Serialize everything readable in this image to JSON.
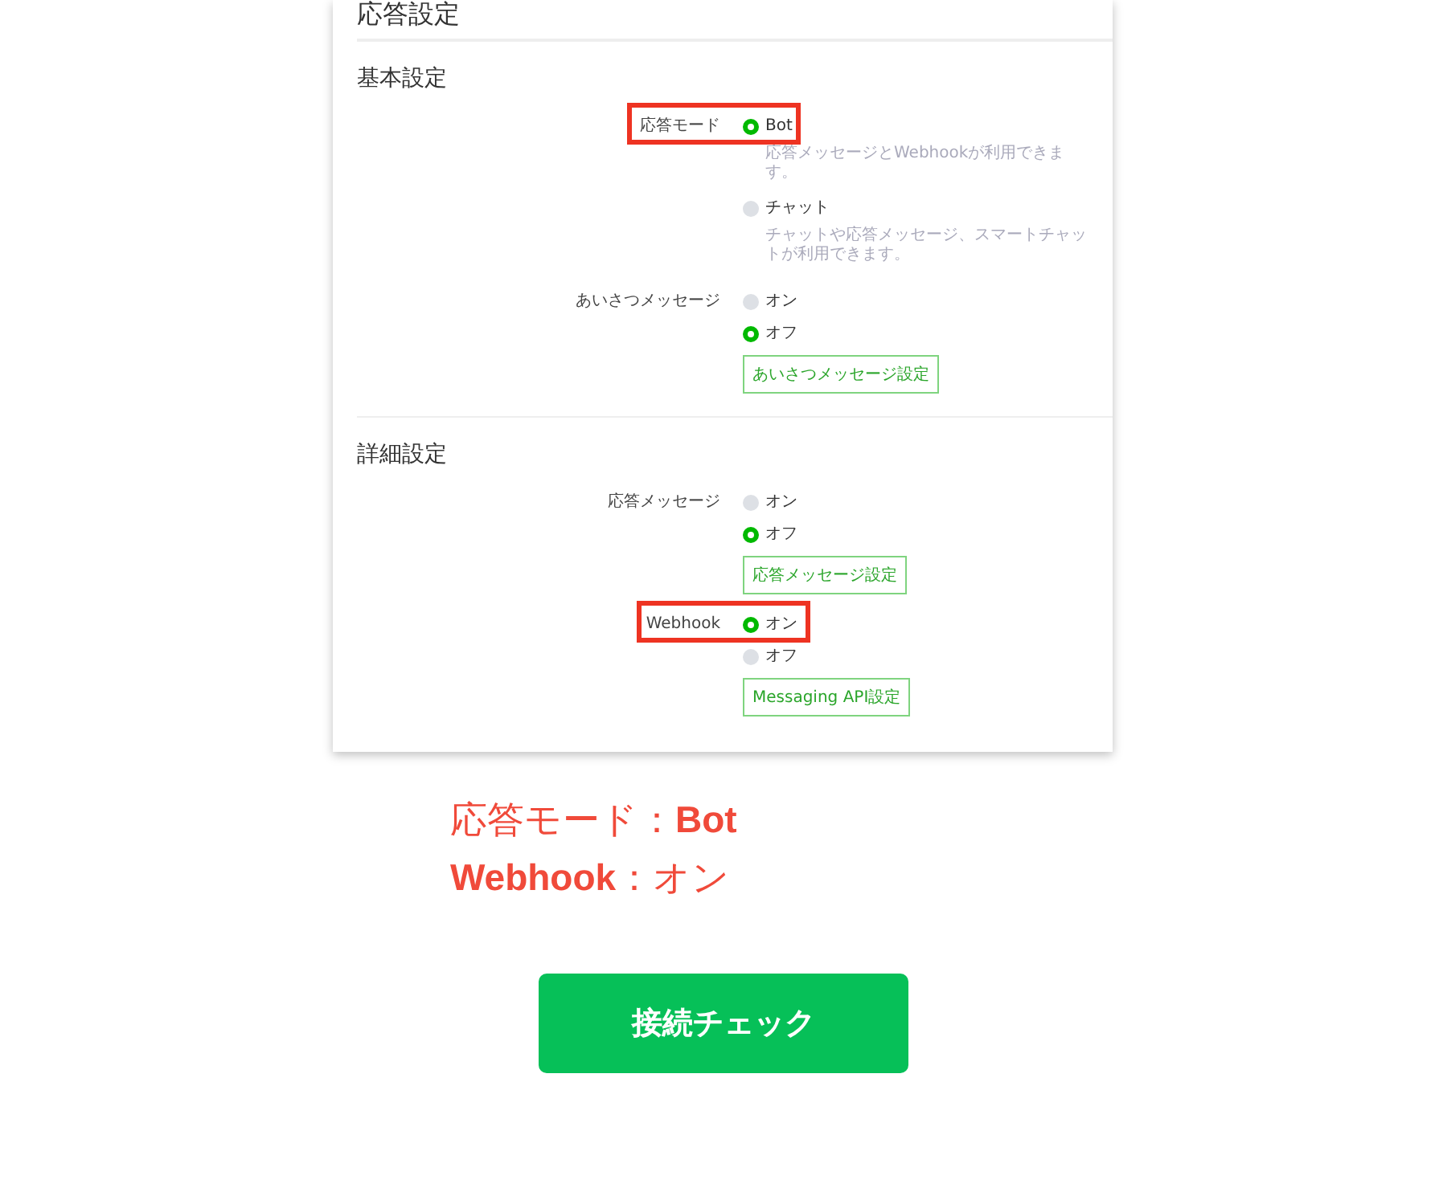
{
  "panel": {
    "title": "応答設定",
    "sections": [
      {
        "title": "基本設定",
        "rows": [
          {
            "label": "応答モード",
            "highlighted": true,
            "options": [
              {
                "label": "Bot",
                "selected": true,
                "note": "応答メッセージとWebhookが利用できます。"
              },
              {
                "label": "チャット",
                "selected": false,
                "note": "チャットや応答メッセージ、スマートチャットが利用できます。"
              }
            ]
          },
          {
            "label": "あいさつメッセージ",
            "highlighted": false,
            "options": [
              {
                "label": "オン",
                "selected": false
              },
              {
                "label": "オフ",
                "selected": true
              }
            ],
            "button": "あいさつメッセージ設定"
          }
        ]
      },
      {
        "title": "詳細設定",
        "rows": [
          {
            "label": "応答メッセージ",
            "highlighted": false,
            "options": [
              {
                "label": "オン",
                "selected": false
              },
              {
                "label": "オフ",
                "selected": true
              }
            ],
            "button": "応答メッセージ設定"
          },
          {
            "label": "Webhook",
            "highlighted": true,
            "options": [
              {
                "label": "オン",
                "selected": true
              },
              {
                "label": "オフ",
                "selected": false
              }
            ],
            "button": "Messaging API設定"
          }
        ]
      }
    ]
  },
  "summary": [
    "応答モード：**Bot**",
    "**Webhook**：オン"
  ],
  "action_button": "接続チェック"
}
